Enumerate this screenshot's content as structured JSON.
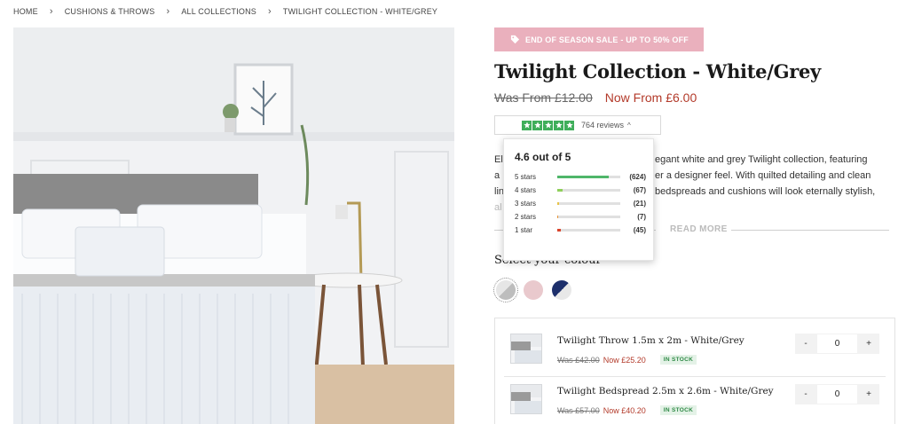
{
  "breadcrumb": {
    "items": [
      "HOME",
      "CUSHIONS & THROWS",
      "ALL COLLECTIONS",
      "TWILIGHT COLLECTION - WHITE/GREY"
    ]
  },
  "hero": {
    "icon": "product-photo"
  },
  "sale_banner": {
    "label": "END OF SEASON SALE - UP TO 50% OFF",
    "color": "#eab0bd"
  },
  "product": {
    "title": "Twilight Collection - White/Grey",
    "was_price": "Was From £12.00",
    "now_price": "Now From £6.00"
  },
  "rating": {
    "stars": 5,
    "reviews_label": "764 reviews",
    "popover": {
      "title": "4.6 out of 5",
      "rows": [
        {
          "label": "5 stars",
          "count": "(624)",
          "fraction": 0.82,
          "color": "#4fb66a"
        },
        {
          "label": "4 stars",
          "count": "(67)",
          "fraction": 0.09,
          "color": "#8fcf5a"
        },
        {
          "label": "3 stars",
          "count": "(21)",
          "fraction": 0.03,
          "color": "#e8c44a"
        },
        {
          "label": "2 stars",
          "count": "(7)",
          "fraction": 0.01,
          "color": "#e8963a"
        },
        {
          "label": "1 star",
          "count": "(45)",
          "fraction": 0.06,
          "color": "#d9442c"
        }
      ]
    }
  },
  "description": {
    "lines": [
      "El",
      "egant white and grey Twilight collection, featuring",
      "a",
      "er a designer feel. With quilted detailing and clean",
      "lin",
      "bedspreads and cushions will look eternally stylish,",
      "al"
    ],
    "read_more": "READ MORE"
  },
  "colour": {
    "label": "Select your colour",
    "swatches": [
      {
        "name": "white-grey",
        "colors": [
          "#e6e6e6",
          "#bdbdbd"
        ],
        "selected": true
      },
      {
        "name": "pink",
        "colors": [
          "#e9c9cd",
          "#e9c9cd"
        ],
        "selected": false
      },
      {
        "name": "navy-white",
        "colors": [
          "#1d2f6b",
          "#e8e8e8"
        ],
        "selected": false
      }
    ]
  },
  "items": [
    {
      "name": "Twilight Throw 1.5m x 2m - White/Grey",
      "was": "Was £42.00",
      "now": "Now £25.20",
      "stock": "IN STOCK",
      "qty": "0",
      "minus": "-",
      "plus": "+"
    },
    {
      "name": "Twilight Bedspread 2.5m x 2.6m - White/Grey",
      "was": "Was £57.00",
      "now": "Now £40.20",
      "stock": "IN STOCK",
      "qty": "0",
      "minus": "-",
      "plus": "+"
    }
  ],
  "colors": {
    "accent_red": "#b33a2a",
    "star_green": "#3fae5a"
  }
}
